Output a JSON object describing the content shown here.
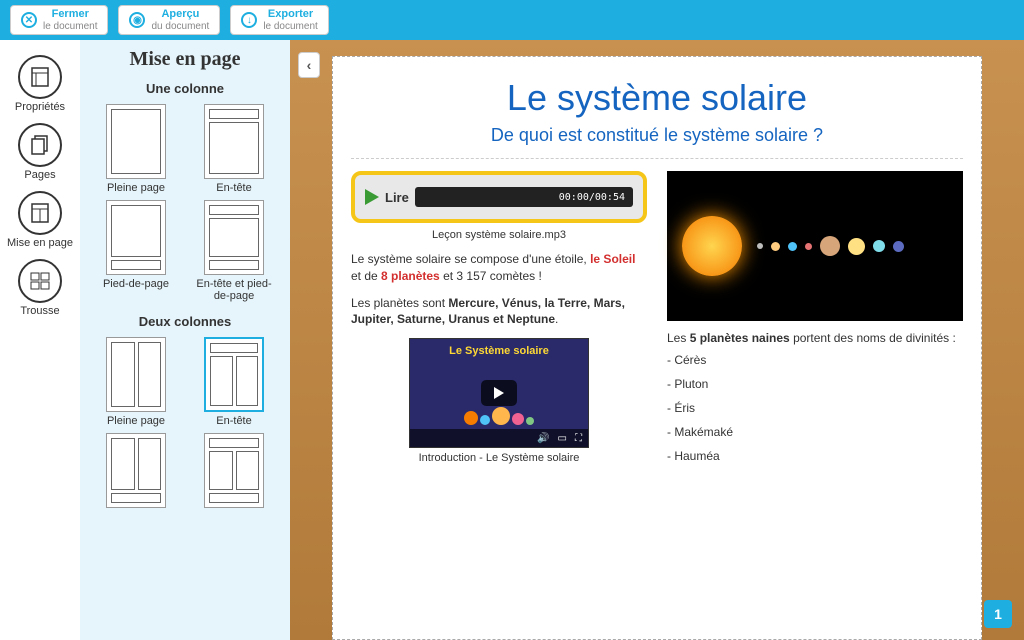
{
  "toolbar": {
    "close": {
      "title": "Fermer",
      "sub": "le document"
    },
    "preview": {
      "title": "Aperçu",
      "sub": "du document"
    },
    "export": {
      "title": "Exporter",
      "sub": "le document"
    }
  },
  "rail": {
    "props": "Propriétés",
    "pages": "Pages",
    "layout": "Mise en page",
    "kit": "Trousse"
  },
  "panel": {
    "title": "Mise en page",
    "one_col": "Une colonne",
    "two_col": "Deux colonnes",
    "full": "Pleine page",
    "header": "En-tête",
    "footer": "Pied-de-page",
    "header_footer": "En-tête et pied-de-page"
  },
  "doc": {
    "title": "Le système solaire",
    "subtitle": "De quoi est constitué le système solaire ?",
    "audio": {
      "play": "Lire",
      "time": "00:00/00:54",
      "caption": "Leçon système solaire.mp3"
    },
    "p1_a": "Le système solaire se compose d'une étoile, ",
    "p1_b": "le Soleil",
    "p1_c": " et de ",
    "p1_d": "8 planètes",
    "p1_e": " et 3 157 comètes !",
    "p2_a": "Les planètes sont ",
    "p2_b": "Mercure, Vénus, la Terre, Mars, Jupiter, Saturne, Uranus et Neptune",
    "p2_c": ".",
    "video": {
      "title": "Le Système solaire",
      "caption": "Introduction - Le Système solaire"
    },
    "dwarf_a": "Les ",
    "dwarf_b": "5 planètes naines",
    "dwarf_c": " portent des noms de divinités :",
    "dwarfs": [
      "- Cérès",
      "- Pluton",
      "- Éris",
      "- Makémaké",
      "- Hauméa"
    ]
  },
  "page_num": "1"
}
